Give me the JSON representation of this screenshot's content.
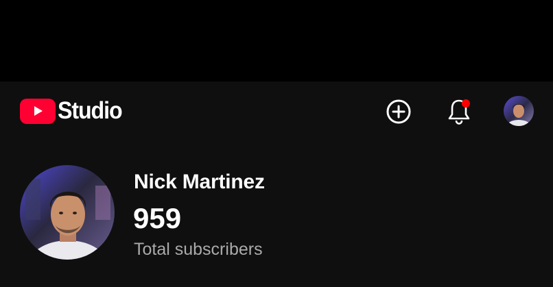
{
  "header": {
    "brand": "Studio",
    "logo_icon": "youtube-play-logo",
    "actions": {
      "create_icon": "plus-circle-icon",
      "notifications_icon": "bell-icon",
      "notification_badge_color": "#ff0000",
      "account_icon": "account-avatar"
    }
  },
  "channel": {
    "name": "Nick Martinez",
    "subscriber_count": "959",
    "subscriber_label": "Total subscribers"
  },
  "colors": {
    "background": "#0f0f0f",
    "brand_red": "#ff0033",
    "secondary_text": "#aaaaaa"
  }
}
